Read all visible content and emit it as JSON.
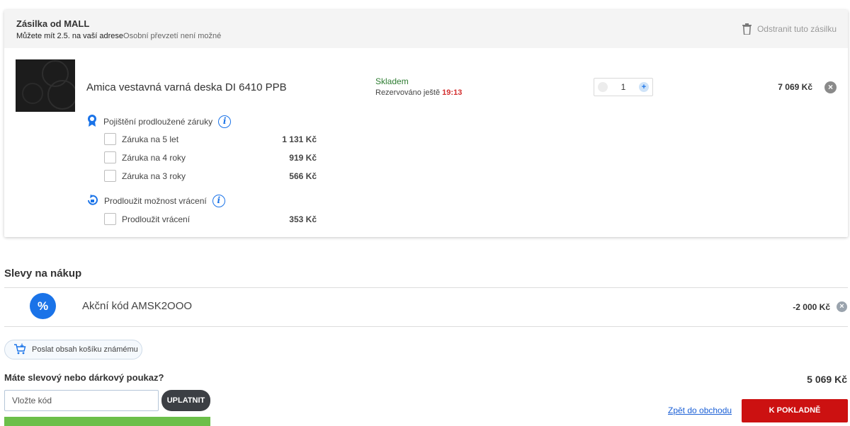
{
  "shipment": {
    "title": "Zásilka od MALL",
    "delivery_text": "Můžete mít 2.5. na vaší adrese",
    "pickup_text": "Osobní převzetí není možné",
    "remove_label": "Odstranit tuto zásilku"
  },
  "product": {
    "name": "Amica vestavná varná deska DI 6410 PPB",
    "stock_status": "Skladem",
    "reserved_label": "Rezervováno ještě",
    "reserved_time": "19:13",
    "quantity": "1",
    "price": "7 069 Kč"
  },
  "warranty": {
    "heading": "Pojištění prodloužené záruky",
    "options": [
      {
        "label": "Záruka na 5 let",
        "price": "1 131 Kč"
      },
      {
        "label": "Záruka na 4 roky",
        "price": "919 Kč"
      },
      {
        "label": "Záruka na 3 roky",
        "price": "566 Kč"
      }
    ]
  },
  "returns": {
    "heading": "Prodloužit možnost vrácení",
    "options": [
      {
        "label": "Prodloužit vrácení",
        "price": "353 Kč"
      }
    ]
  },
  "discounts": {
    "title": "Slevy na nákup",
    "icon_symbol": "%",
    "promo_label": "Akční kód AMSK2OOO",
    "promo_amount": "-2 000 Kč"
  },
  "share": {
    "label": "Poslat obsah košíku známému"
  },
  "voucher": {
    "question": "Máte slevový nebo dárkový poukaz?",
    "placeholder": "Vložte kód",
    "apply_label": "UPLATNIT"
  },
  "summary": {
    "total": "5 069 Kč",
    "back_link": "Zpět do obchodu",
    "checkout_label": "K POKLADNĚ"
  },
  "colors": {
    "accent_blue": "#1a73e8",
    "checkout_red": "#cc1111",
    "stock_green": "#2e7d32",
    "time_red": "#d32f2f"
  }
}
